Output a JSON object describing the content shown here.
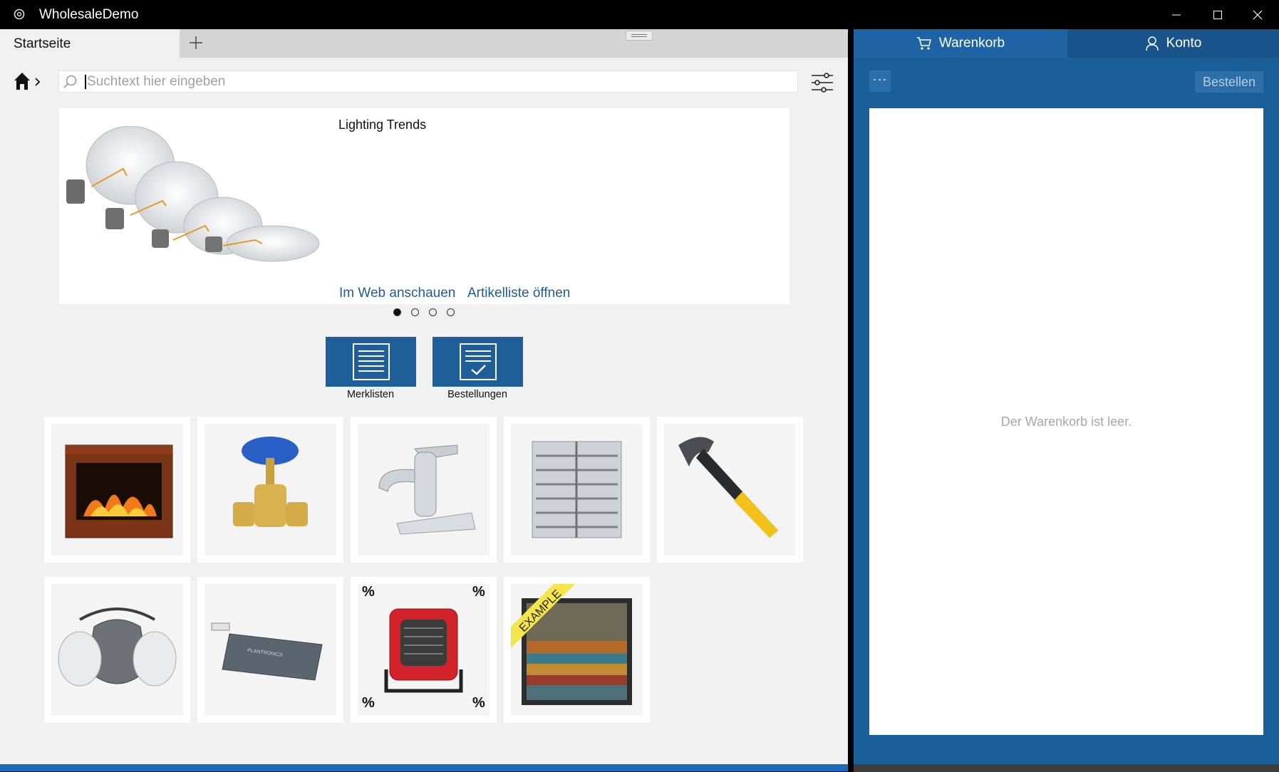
{
  "window": {
    "title": "WholesaleDemo"
  },
  "tabs": {
    "active_label": "Startseite",
    "add_symbol": "+"
  },
  "search": {
    "placeholder": "Suchtext hier eingeben",
    "value": ""
  },
  "banner": {
    "title": "Lighting Trends",
    "link_web": "Im Web anschauen",
    "link_list": "Artikelliste öffnen",
    "pages": 4,
    "active_page": 1
  },
  "quick_actions": [
    {
      "label": "Merklisten",
      "icon": "list-icon"
    },
    {
      "label": "Bestellungen",
      "icon": "order-check-icon"
    }
  ],
  "products": [
    {
      "name": "fireplace"
    },
    {
      "name": "valve"
    },
    {
      "name": "faucet"
    },
    {
      "name": "exhaust-fan"
    },
    {
      "name": "hammer"
    },
    {
      "name": "respirator-mask"
    },
    {
      "name": "battery"
    },
    {
      "name": "heater",
      "discount_marks": [
        "%",
        "%",
        "%",
        "%"
      ]
    },
    {
      "name": "painting",
      "ribbon": "EXAMPLE"
    }
  ],
  "cart": {
    "tab_label": "Warenkorb",
    "account_label": "Konto",
    "more_label": "···",
    "order_button": "Bestellen",
    "empty_message": "Der Warenkorb ist leer."
  },
  "colors": {
    "accent": "#1e5f99",
    "link": "#1d5c93",
    "pane": "#1a5f9a"
  }
}
